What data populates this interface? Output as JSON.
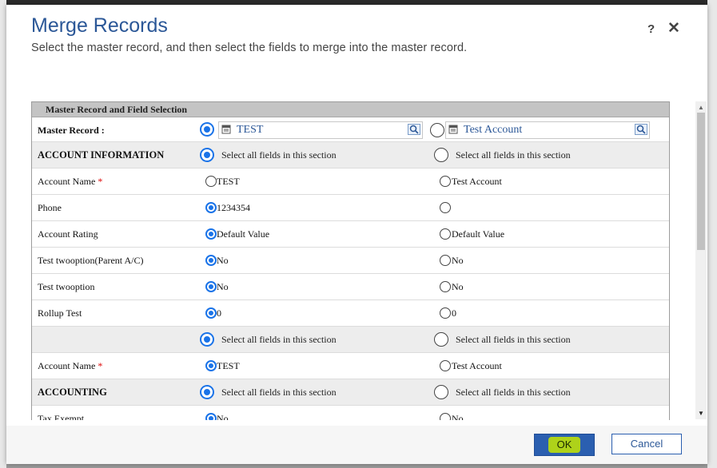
{
  "dialog": {
    "title": "Merge Records",
    "subtitle": "Select the master record, and then select the fields to merge into the master record.",
    "help": "?",
    "close": "✕"
  },
  "grid": {
    "header": "Master Record and Field Selection",
    "master": {
      "label": "Master Record :",
      "left": "TEST",
      "right": "Test Account",
      "selected": "left"
    },
    "select_all_text": "Select all fields in this section",
    "rows": [
      {
        "kind": "section",
        "label": "ACCOUNT INFORMATION",
        "selected": "left"
      },
      {
        "kind": "field",
        "label": "Account Name",
        "required": true,
        "left": "TEST",
        "right": "Test Account",
        "selected": "none"
      },
      {
        "kind": "field",
        "label": "Phone",
        "required": false,
        "left": "1234354",
        "right": "",
        "selected": "left"
      },
      {
        "kind": "field",
        "label": "Account Rating",
        "required": false,
        "left": "Default Value",
        "right": "Default Value",
        "selected": "left"
      },
      {
        "kind": "field",
        "label": "Test twooption(Parent A/C)",
        "required": false,
        "left": "No",
        "right": "No",
        "selected": "left"
      },
      {
        "kind": "field",
        "label": "Test twooption",
        "required": false,
        "left": "No",
        "right": "No",
        "selected": "left"
      },
      {
        "kind": "field",
        "label": "Rollup Test",
        "required": false,
        "left": "0",
        "right": "0",
        "selected": "left"
      },
      {
        "kind": "section",
        "label": "",
        "selected": "left"
      },
      {
        "kind": "field",
        "label": "Account Name",
        "required": true,
        "left": "TEST",
        "right": "Test Account",
        "selected": "left"
      },
      {
        "kind": "section",
        "label": "ACCOUNTING",
        "selected": "left"
      },
      {
        "kind": "field",
        "label": "Tax Exempt",
        "required": false,
        "left": "No",
        "right": "No",
        "selected": "left"
      }
    ]
  },
  "footer": {
    "ok": "OK",
    "cancel": "Cancel"
  },
  "colors": {
    "accent": "#2b5797",
    "radio": "#1a73e8",
    "ok_bg": "#2b5fb0",
    "highlight": "#c6e600"
  }
}
